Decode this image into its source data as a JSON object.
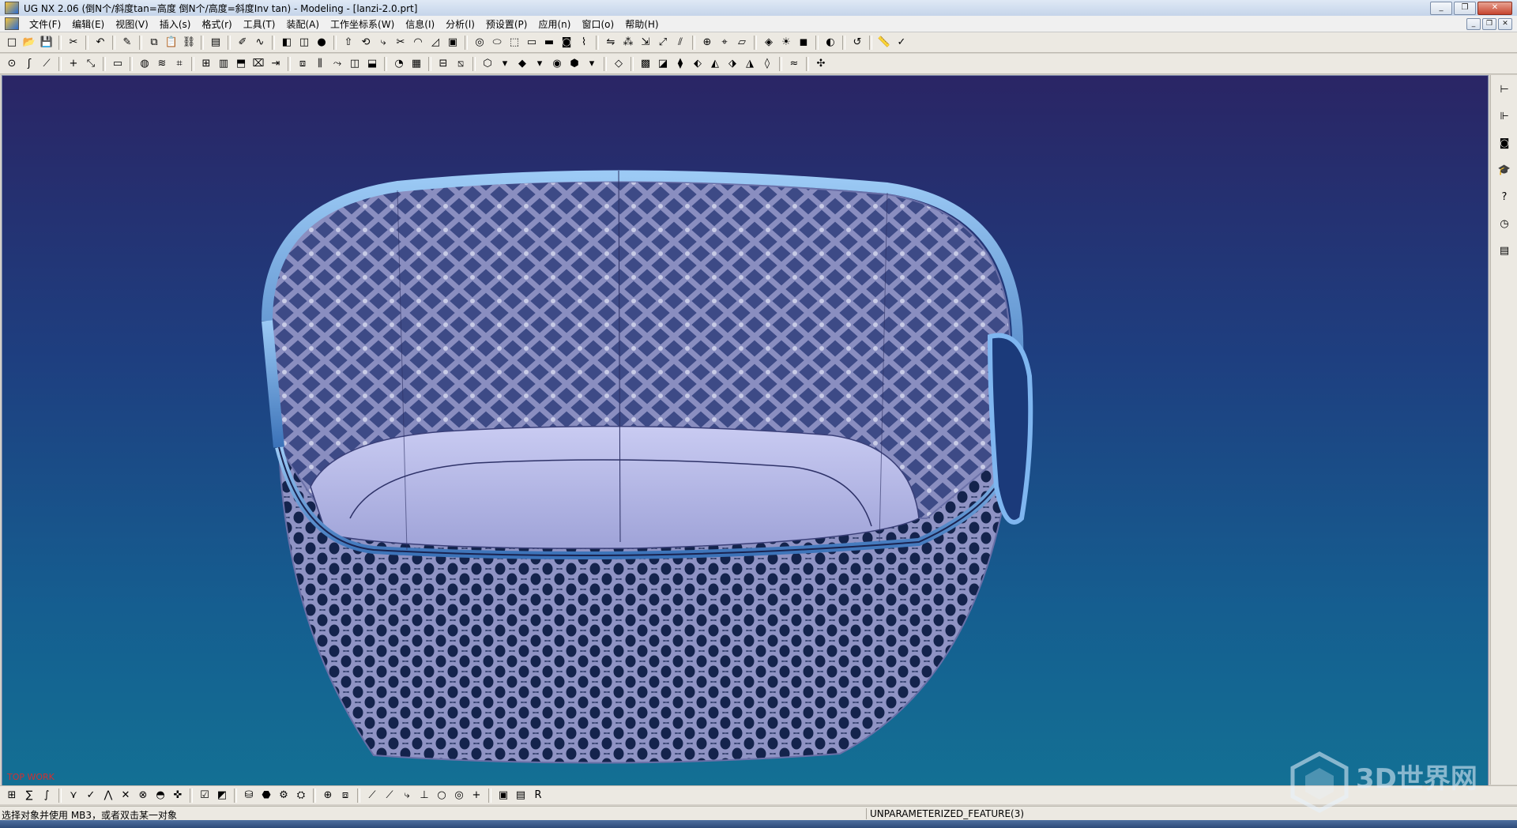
{
  "window": {
    "title": "UG NX 2.06  (倒N个/斜度tan=高度    倒N个/高度=斜度Inv tan) - Modeling - [lanzi-2.0.prt]",
    "minimize": "_",
    "restore": "❐",
    "close": "✕"
  },
  "menu": {
    "items": [
      "文件(F)",
      "编辑(E)",
      "视图(V)",
      "插入(s)",
      "格式(r)",
      "工具(T)",
      "装配(A)",
      "工作坐标系(W)",
      "信息(I)",
      "分析(l)",
      "预设置(P)",
      "应用(n)",
      "窗口(o)",
      "帮助(H)"
    ]
  },
  "toolbar1": {
    "icons": [
      "new-icon",
      "open-icon",
      "save-icon",
      "sep",
      "cut-icon",
      "sep",
      "undo-icon",
      "sep",
      "edit-icon",
      "sep",
      "copy-icon",
      "paste-icon",
      "link-icon",
      "sep",
      "layer-icon",
      "sep",
      "sketch-icon",
      "curve-icon",
      "sep",
      "block-icon",
      "cylinder-icon",
      "sphere-icon",
      "sep",
      "extrude-icon",
      "revolve-icon",
      "sweep-icon",
      "trim-icon",
      "blend-icon",
      "chamfer-icon",
      "shell-icon",
      "sep",
      "hole-icon",
      "boss-icon",
      "pocket-icon",
      "pad-icon",
      "slot-icon",
      "groove-icon",
      "thread-icon",
      "sep",
      "mirror-icon",
      "pattern-icon",
      "offset-icon",
      "scale-icon",
      "split-icon",
      "sep",
      "datum-icon",
      "csys-icon",
      "plane-icon",
      "sep",
      "render-icon",
      "light-icon",
      "shaded-icon",
      "sep",
      "hide-icon",
      "sep",
      "undo-feature-icon",
      "sep",
      "measure-icon",
      "analyze-icon"
    ],
    "glyphs": [
      "□",
      "📂",
      "💾",
      "|",
      "✂",
      "|",
      "↶",
      "|",
      "✎",
      "|",
      "⧉",
      "📋",
      "⛓",
      "|",
      "▤",
      "|",
      "✐",
      "∿",
      "|",
      "◧",
      "◫",
      "●",
      "|",
      "⇧",
      "⟲",
      "⤷",
      "✂",
      "◠",
      "◿",
      "▣",
      "|",
      "◎",
      "⬭",
      "⬚",
      "▭",
      "▬",
      "◙",
      "⌇",
      "|",
      "⇋",
      "⁂",
      "⇲",
      "⤢",
      "⫽",
      "|",
      "⊕",
      "⌖",
      "▱",
      "|",
      "◈",
      "☀",
      "◼",
      "|",
      "◐",
      "|",
      "↺",
      "|",
      "📏",
      "✓"
    ]
  },
  "toolbar2": {
    "icons": [
      "point-icon",
      "spline-icon",
      "line-icon",
      "sep",
      "plus-icon",
      "arrows-icon",
      "sep",
      "rectangle-icon",
      "sep",
      "face-icon",
      "bridge-icon",
      "curve-mesh-icon",
      "sep",
      "sew-icon",
      "patch-icon",
      "thicken-icon",
      "trim-sheet-icon",
      "extend-icon",
      "sep",
      "ruled-icon",
      "through-curves-icon",
      "swept-icon",
      "section-icon",
      "offset-face-icon",
      "sep",
      "blend-face-icon",
      "quilt-icon",
      "sep",
      "section-view-icon",
      "plane-cut-icon",
      "sep",
      "view-cube-icon",
      "dropdown-icon",
      "view-front-icon",
      "dropdown-icon",
      "color-icon",
      "view-iso-icon",
      "dropdown-icon",
      "sep",
      "render-style-icon",
      "sep",
      "form-icon",
      "freeform-icon",
      "fit-icon",
      "morph-icon",
      "global-shape-icon",
      "deform-icon",
      "warp-icon",
      "smooth-icon",
      "sep",
      "iso-curve-icon",
      "sep",
      "analysis-icon"
    ],
    "glyphs": [
      "⊙",
      "ʃ",
      "⟋",
      "|",
      "+",
      "⤡",
      "|",
      "▭",
      "|",
      "◍",
      "≋",
      "⌗",
      "|",
      "⊞",
      "▥",
      "⬒",
      "⌧",
      "⇥",
      "|",
      "⧈",
      "⫼",
      "⤳",
      "◫",
      "⬓",
      "|",
      "◔",
      "▦",
      "|",
      "⊟",
      "⧅",
      "|",
      "⬡",
      "▾",
      "◆",
      "▾",
      "◉",
      "⬢",
      "▾",
      "|",
      "◇",
      "|",
      "▩",
      "◪",
      "⧫",
      "⬖",
      "◭",
      "⬗",
      "◮",
      "◊",
      "|",
      "≈",
      "|",
      "✣"
    ]
  },
  "bottom_toolbar": {
    "icons": [
      "snap-grid-icon",
      "snap-curve-icon",
      "snap-surface-icon",
      "sep",
      "endpoint-icon",
      "midpoint-icon",
      "control-point-icon",
      "intersection-icon",
      "center-icon",
      "quadrant-icon",
      "existing-point-icon",
      "sep",
      "select-all-icon",
      "select-face-icon",
      "sep",
      "filter-icon",
      "body-icon",
      "feature-icon",
      "component-icon",
      "sep",
      "crosshair-icon",
      "snap-active-icon",
      "sep",
      "line-snap-icon",
      "tangent-snap-icon",
      "curve-snap-icon",
      "perp-icon",
      "circle-icon",
      "center-point-icon",
      "plus-small-icon",
      "sep",
      "image-icon",
      "display-icon",
      "r-icon"
    ],
    "glyphs": [
      "⊞",
      "∑",
      "∫",
      "|",
      "⋎",
      "✓",
      "⋀",
      "✕",
      "⊗",
      "◓",
      "✜",
      "|",
      "☑",
      "◩",
      "|",
      "⛁",
      "⬣",
      "⚙",
      "⛭",
      "|",
      "⊕",
      "⧈",
      "|",
      "⟋",
      "⟋",
      "⤷",
      "⊥",
      "○",
      "◎",
      "+",
      "|",
      "▣",
      "▤",
      "R"
    ]
  },
  "right_toolbar": {
    "icons": [
      "assembly-navigator-icon",
      "part-navigator-icon",
      "history-icon",
      "training-icon",
      "help-icon",
      "clock-icon",
      "report-icon"
    ],
    "glyphs": [
      "⊢",
      "⊩",
      "◙",
      "🎓",
      "?",
      "◷",
      "▤"
    ]
  },
  "viewport": {
    "wcs_label": "TOP WORK",
    "model": "lanzi-2.0.prt",
    "background_top": "#2a2565",
    "background_bottom": "#137094",
    "model_color": "#6e72a8",
    "rim_color": "#4a8fd8"
  },
  "status": {
    "prompt": "选择对象并使用 MB3，或者双击某一对象",
    "feature": "UNPARAMETERIZED_FEATURE(3)"
  },
  "watermark": {
    "text": "3D世界网"
  }
}
